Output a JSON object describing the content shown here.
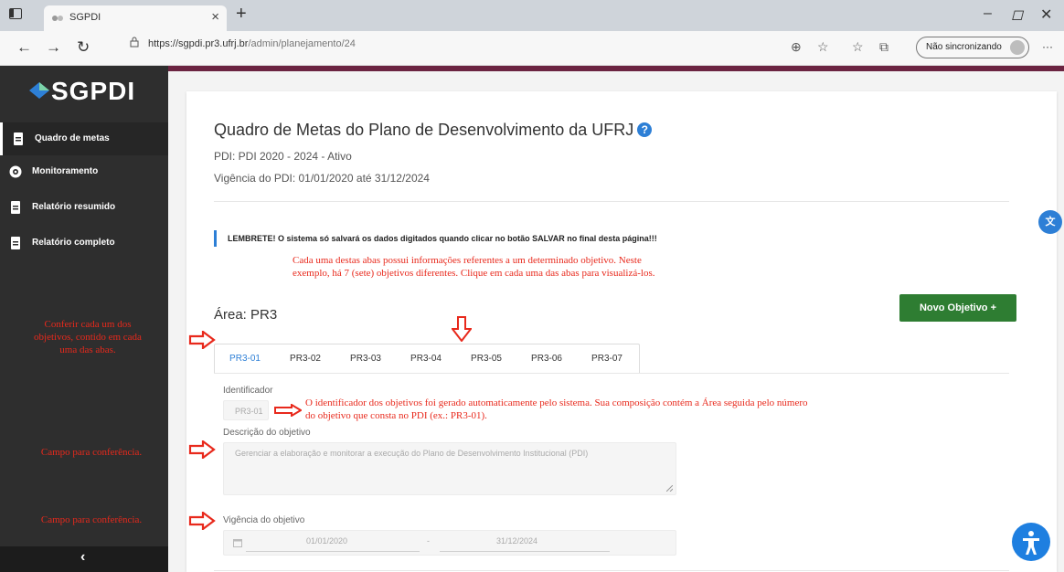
{
  "browser": {
    "tab_title": "SGPDI",
    "url_host": "https://sgpdi.pr3.ufrj.br",
    "url_path": "/admin/planejamento/24",
    "sync_label": "Não sincronizando",
    "more": "···"
  },
  "sidebar": {
    "logo": "SGPDI",
    "items": [
      {
        "label": "Quadro de metas",
        "icon": "document-icon"
      },
      {
        "label": "Monitoramento",
        "icon": "eye-icon"
      },
      {
        "label": "Relatório resumido",
        "icon": "document-icon"
      },
      {
        "label": "Relatório completo",
        "icon": "document-icon"
      }
    ],
    "collapse": "‹"
  },
  "notes": {
    "tabs_hint": "Conferir cada um dos objetivos, contido em cada uma das abas.",
    "field_check_1": "Campo para conferência.",
    "field_check_2": "Campo para conferência.",
    "abas_desc": "Cada uma destas abas possui informações referentes a um determinado objetivo. Neste exemplo, há 7 (sete) objetivos diferentes. Clique em cada uma das abas para visualizá-los.",
    "identificador_desc": "O identificador dos objetivos foi gerado automaticamente pelo sistema. Sua composição contém a Área seguida pelo número do objetivo que consta no PDI (ex.: PR3-01)."
  },
  "page": {
    "title": "Quadro de Metas do Plano de Desenvolvimento da UFRJ",
    "help": "?",
    "pdi": "PDI: PDI 2020 - 2024 - Ativo",
    "vigencia_pdi": "Vigência do PDI: 01/01/2020 até 31/12/2024",
    "reminder": "LEMBRETE! O sistema só salvará os dados digitados quando clicar no botão SALVAR no final desta página!!!",
    "area": "Área: PR3",
    "novo_objetivo": "Novo Objetivo  +",
    "tabs": [
      "PR3-01",
      "PR3-02",
      "PR3-03",
      "PR3-04",
      "PR3-05",
      "PR3-06",
      "PR3-07"
    ],
    "active_tab": "PR3-01",
    "identificador_label": "Identificador",
    "identificador_value": "PR3-01",
    "descricao_label": "Descrição do objetivo",
    "descricao_value": "Gerenciar a elaboração e monitorar a execução do Plano de Desenvolvimento Institucional (PDI)",
    "vigencia_obj_label": "Vigência do objetivo",
    "date_start": "01/01/2020",
    "date_sep": "-",
    "date_end": "31/12/2024"
  },
  "colors": {
    "accent": "#6b2441",
    "sidebar": "#2e2e2e",
    "primary": "#2d7fd6",
    "success": "#2e7d32",
    "annotation": "#e8291c"
  }
}
